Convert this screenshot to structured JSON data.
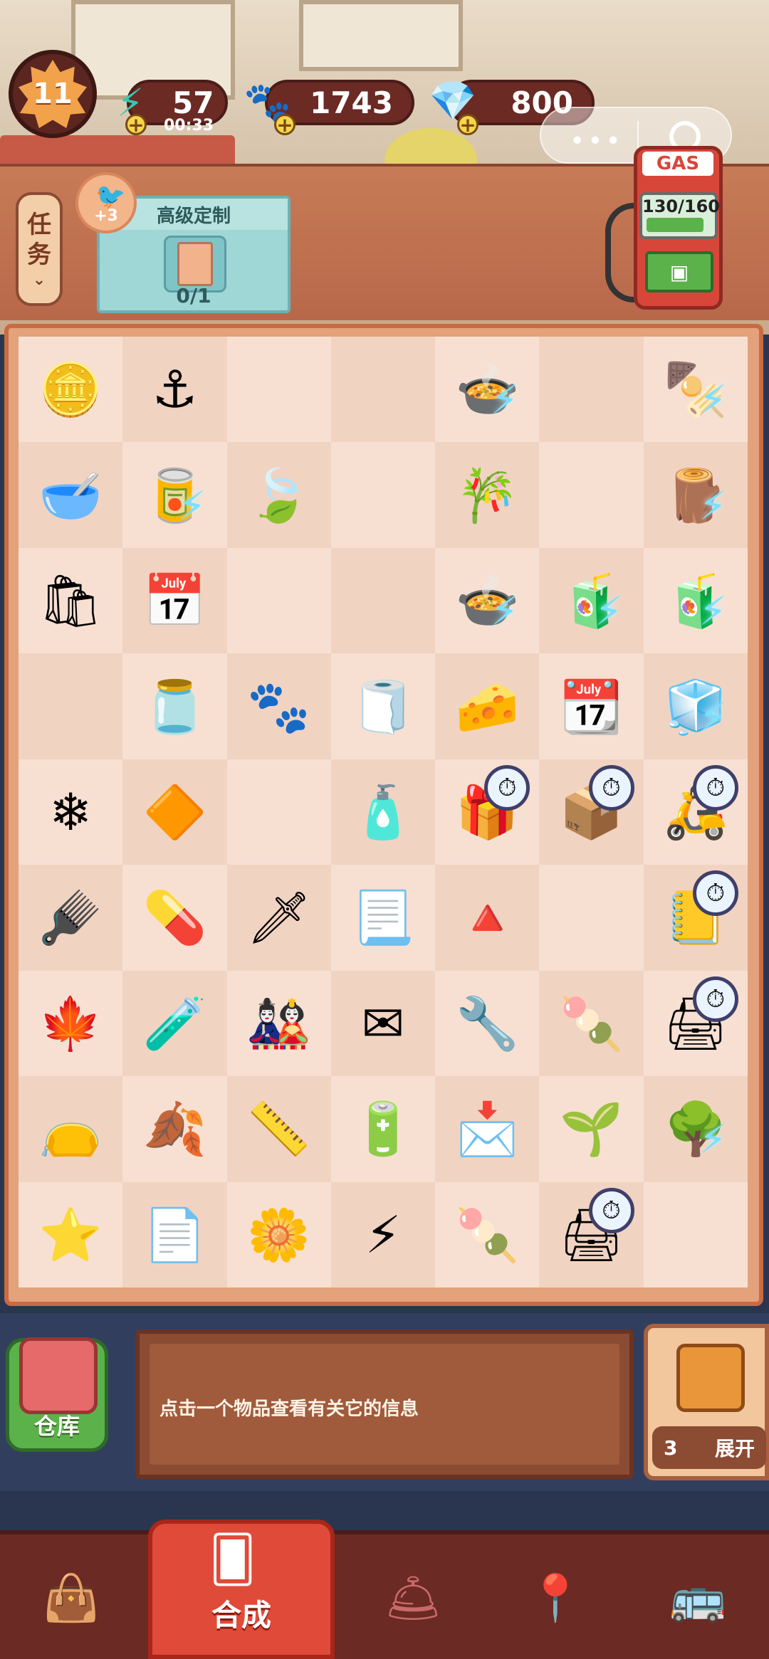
{
  "hud": {
    "level": "11",
    "energy": {
      "value": "57",
      "timer": "00:33"
    },
    "coins": "1743",
    "gems": "800"
  },
  "order": {
    "task_tab_label_1": "任",
    "task_tab_label_2": "务",
    "reward_label": "+3",
    "title": "高级定制",
    "count": "0/1"
  },
  "gas_pump": {
    "label": "GAS",
    "fuel": "130/160",
    "fuel_fraction": 0.8125
  },
  "board": {
    "cells": [
      {
        "icon": "silver-ingots",
        "glyph": "🪙"
      },
      {
        "icon": "hook",
        "glyph": "⚓"
      },
      {
        "icon": "empty",
        "glyph": ""
      },
      {
        "icon": "empty",
        "glyph": ""
      },
      {
        "icon": "hotpot-bowl",
        "glyph": "🍲",
        "bolt": true
      },
      {
        "icon": "empty",
        "glyph": ""
      },
      {
        "icon": "skewer-pot",
        "glyph": "🍢",
        "bolt": true
      },
      {
        "icon": "soup-bowl",
        "glyph": "🥣"
      },
      {
        "icon": "sugar-can",
        "glyph": "🥫",
        "bolt": true
      },
      {
        "icon": "tea-leaf-pile",
        "glyph": "🍃"
      },
      {
        "icon": "empty",
        "glyph": ""
      },
      {
        "icon": "cut-sugarcane",
        "glyph": "🎋"
      },
      {
        "icon": "empty",
        "glyph": ""
      },
      {
        "icon": "sugarcane-bundle",
        "glyph": "🪵",
        "bolt": true
      },
      {
        "icon": "paper-bag",
        "glyph": "🛍"
      },
      {
        "icon": "calendar-3",
        "glyph": "📅"
      },
      {
        "icon": "empty",
        "glyph": ""
      },
      {
        "icon": "empty",
        "glyph": ""
      },
      {
        "icon": "skewer-hotpot",
        "glyph": "🍲",
        "bolt": true
      },
      {
        "icon": "drinks-crate",
        "glyph": "🧃",
        "bolt": true
      },
      {
        "icon": "drinks-crate-full",
        "glyph": "🧃",
        "bolt": true
      },
      {
        "icon": "empty",
        "glyph": ""
      },
      {
        "icon": "red-jar",
        "glyph": "🫙"
      },
      {
        "icon": "paw-jar",
        "glyph": "🐾"
      },
      {
        "icon": "folded-cloth",
        "glyph": "🧻"
      },
      {
        "icon": "cheese",
        "glyph": "🧀"
      },
      {
        "icon": "calendar-6",
        "glyph": "📆"
      },
      {
        "icon": "display-fridge",
        "glyph": "🧊",
        "bolt": true
      },
      {
        "icon": "snowflake",
        "glyph": "❄"
      },
      {
        "icon": "orange-gem",
        "glyph": "🔶"
      },
      {
        "icon": "empty",
        "glyph": ""
      },
      {
        "icon": "ink-bottle",
        "glyph": "🧴"
      },
      {
        "icon": "gift-box",
        "glyph": "🎁",
        "timer": true
      },
      {
        "icon": "hand-truck",
        "glyph": "📦",
        "timer": true
      },
      {
        "icon": "delivery-scooter",
        "glyph": "🛵",
        "timer": true
      },
      {
        "icon": "hair-brush",
        "glyph": "🪮"
      },
      {
        "icon": "medicine-bottle",
        "glyph": "💊"
      },
      {
        "icon": "kunai",
        "glyph": "🗡"
      },
      {
        "icon": "paper-sheet",
        "glyph": "📃"
      },
      {
        "icon": "red-triangle",
        "glyph": "🔺"
      },
      {
        "icon": "empty",
        "glyph": ""
      },
      {
        "icon": "notepad",
        "glyph": "📒",
        "timer": true
      },
      {
        "icon": "maple-wreath",
        "glyph": "🍁"
      },
      {
        "icon": "bottles",
        "glyph": "🧪"
      },
      {
        "icon": "teru-doll",
        "glyph": "🎎"
      },
      {
        "icon": "envelope-open",
        "glyph": "✉"
      },
      {
        "icon": "wrench",
        "glyph": "🔧"
      },
      {
        "icon": "skewer-card",
        "glyph": "🍡"
      },
      {
        "icon": "printer",
        "glyph": "🖨",
        "timer": true
      },
      {
        "icon": "tea-sack",
        "glyph": "👝"
      },
      {
        "icon": "tea-mat",
        "glyph": "🍂"
      },
      {
        "icon": "ruler",
        "glyph": "📏"
      },
      {
        "icon": "battery",
        "glyph": "🔋"
      },
      {
        "icon": "envelope",
        "glyph": "📩"
      },
      {
        "icon": "sprout",
        "glyph": "🌱"
      },
      {
        "icon": "bonsai-tree",
        "glyph": "🌳",
        "bolt": true
      },
      {
        "icon": "star",
        "glyph": "⭐"
      },
      {
        "icon": "paper-stack",
        "glyph": "📄"
      },
      {
        "icon": "flower-card",
        "glyph": "🌼"
      },
      {
        "icon": "power-disc",
        "glyph": "⚡"
      },
      {
        "icon": "skewer-cards",
        "glyph": "🍡"
      },
      {
        "icon": "small-printer",
        "glyph": "🖨",
        "timer": true
      },
      {
        "icon": "empty",
        "glyph": ""
      }
    ]
  },
  "info": {
    "text": "点击一个物品查看有关它的信息"
  },
  "storage": {
    "label": "仓库"
  },
  "expand": {
    "count": "3",
    "label": "展开"
  },
  "nav": {
    "merge_label": "合成"
  },
  "colors": {
    "board": "#e3a27b",
    "cell_light": "#f7e0d2",
    "cell_dark": "#f1d3c2",
    "footer": "#6b2a24",
    "merge_tab": "#e04a38"
  }
}
